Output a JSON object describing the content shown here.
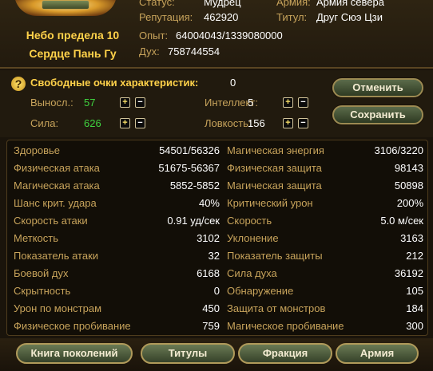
{
  "header": {
    "name_line1": "Небо предела 10",
    "name_line2": "Сердце Пань Гу",
    "status_label": "Статус:",
    "status_value": "Мудрец",
    "army_label": "Армия:",
    "army_value": "Армия севера",
    "reputation_label": "Репутация:",
    "reputation_value": "462920",
    "title_label": "Титул:",
    "title_value": "Друг Сюэ Цзи",
    "exp_label": "Опыт:",
    "exp_value": "64004043/1339080000",
    "spirit_label": "Дух:",
    "spirit_value": "758744554"
  },
  "attributes": {
    "free_label": "Свободные очки характеристик:",
    "free_value": "0",
    "endurance_label": "Выносл.:",
    "endurance_value": "57",
    "strength_label": "Сила:",
    "strength_value": "626",
    "intellect_label": "Интеллект:",
    "intellect_value": "5",
    "agility_label": "Ловкость:",
    "agility_value": "156",
    "plus_glyph": "+",
    "minus_glyph": "−",
    "cancel_label": "Отменить",
    "save_label": "Сохранить",
    "colors": {
      "endurance": "#3fd23f",
      "strength": "#3fd23f"
    }
  },
  "stats": {
    "left": [
      {
        "label": "Здоровье",
        "value": "54501/56326"
      },
      {
        "label": "Физическая атака",
        "value": "51675-56367"
      },
      {
        "label": "Магическая атака",
        "value": "5852-5852"
      },
      {
        "label": "Шанс крит. удара",
        "value": "40%"
      },
      {
        "label": "Скорость атаки",
        "value": "0.91 уд/сек"
      },
      {
        "label": "Меткость",
        "value": "3102"
      },
      {
        "label": "Показатель атаки",
        "value": "32"
      },
      {
        "label": "Боевой дух",
        "value": "6168"
      },
      {
        "label": "Скрытность",
        "value": "0"
      },
      {
        "label": "Урон по монстрам",
        "value": "450"
      },
      {
        "label": "Физическое пробивание",
        "value": "759"
      }
    ],
    "right": [
      {
        "label": "Магическая энергия",
        "value": "3106/3220"
      },
      {
        "label": "Физическая защита",
        "value": "98143"
      },
      {
        "label": "Магическая защита",
        "value": "50898"
      },
      {
        "label": "Критический урон",
        "value": "200%"
      },
      {
        "label": "Скорость",
        "value": "5.0 м/сек"
      },
      {
        "label": "Уклонение",
        "value": "3163"
      },
      {
        "label": "Показатель защиты",
        "value": "212"
      },
      {
        "label": "Сила духа",
        "value": "36192"
      },
      {
        "label": "Обнаружение",
        "value": "105"
      },
      {
        "label": "Защита от монстров",
        "value": "184"
      },
      {
        "label": "Магическое пробивание",
        "value": "300"
      }
    ]
  },
  "bottom_buttons": {
    "generations": "Книга поколений",
    "titles": "Титулы",
    "faction": "Фракция",
    "army": "Армия"
  }
}
